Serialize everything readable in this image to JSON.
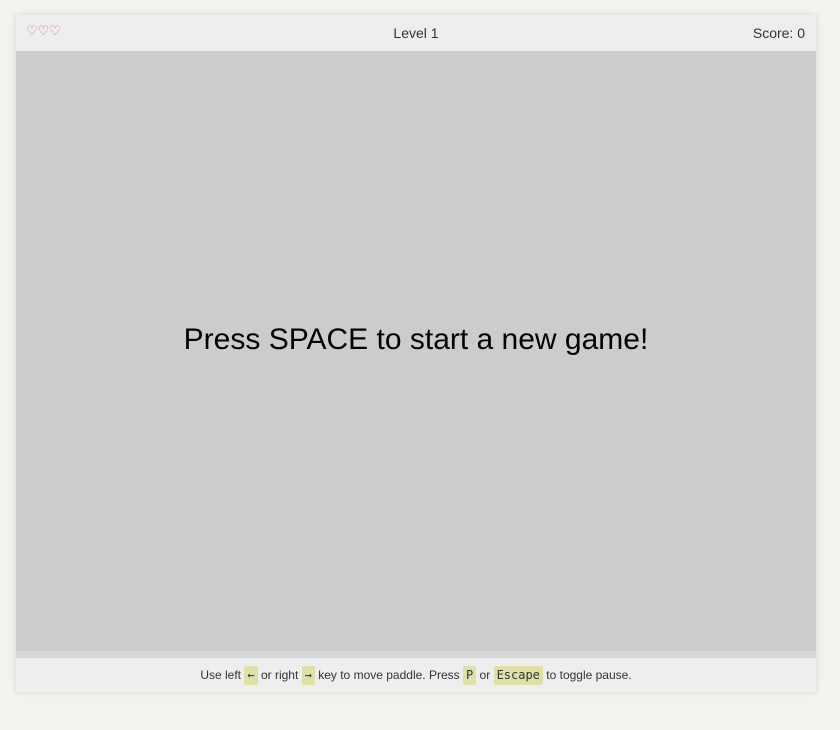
{
  "hud": {
    "lives_icons": "♡♡♡",
    "level": "Level 1",
    "score": "Score: 0"
  },
  "canvas": {
    "message": "Press SPACE to start a new game!"
  },
  "help": {
    "part1": "Use left",
    "key_left": "←",
    "part2": "or right",
    "key_right": "→",
    "part3": "key to move paddle. Press",
    "key_p": "P",
    "part4": "or",
    "key_escape": "Escape",
    "part5": "to toggle pause."
  },
  "colors": {
    "background": "#f3f2ec",
    "canvas": "#cccccc",
    "hud": "#eeeeee",
    "heart": "#e06a6a",
    "kbd": "#dfe0a8"
  },
  "icons": {
    "life": "heart-outline-icon"
  }
}
